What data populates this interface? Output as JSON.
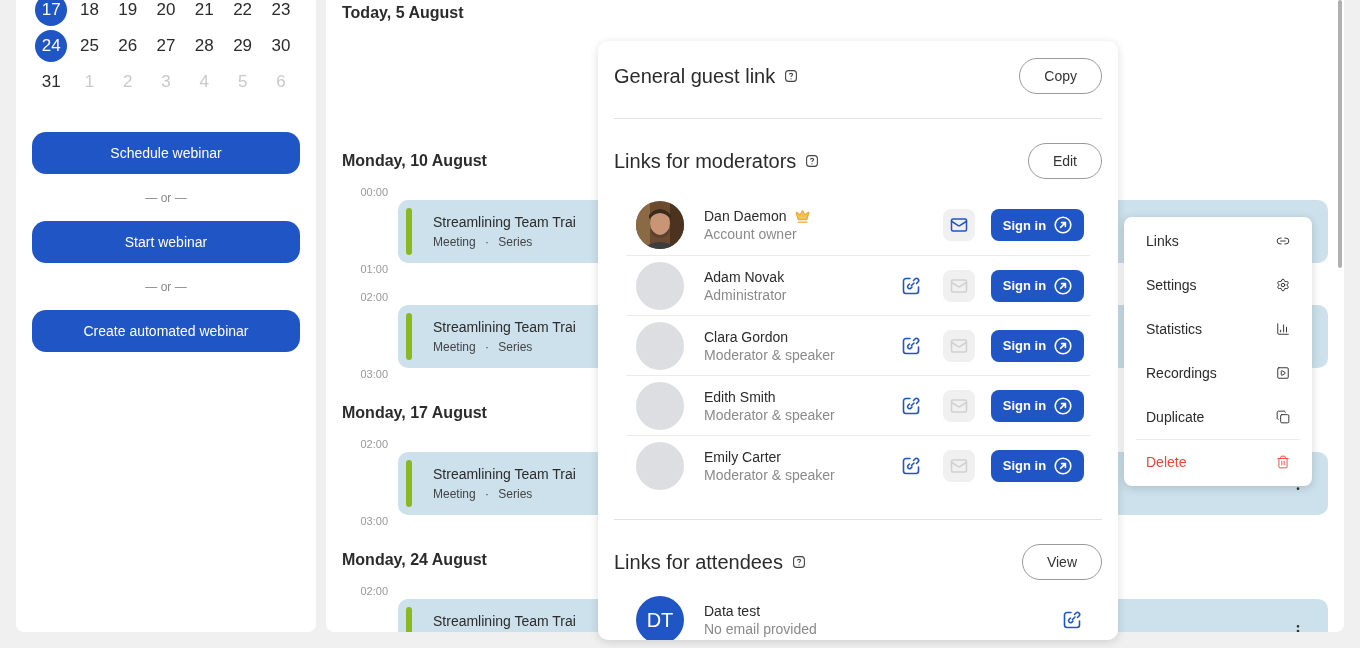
{
  "calendar": {
    "weeks": [
      [
        {
          "day": "17",
          "selected": true,
          "muted": false
        },
        {
          "day": "18",
          "selected": false,
          "muted": false
        },
        {
          "day": "19",
          "selected": false,
          "muted": false
        },
        {
          "day": "20",
          "selected": false,
          "muted": false
        },
        {
          "day": "21",
          "selected": false,
          "muted": false
        },
        {
          "day": "22",
          "selected": false,
          "muted": false
        },
        {
          "day": "23",
          "selected": false,
          "muted": false
        }
      ],
      [
        {
          "day": "24",
          "selected": true,
          "muted": false
        },
        {
          "day": "25",
          "selected": false,
          "muted": false
        },
        {
          "day": "26",
          "selected": false,
          "muted": false
        },
        {
          "day": "27",
          "selected": false,
          "muted": false
        },
        {
          "day": "28",
          "selected": false,
          "muted": false
        },
        {
          "day": "29",
          "selected": false,
          "muted": false
        },
        {
          "day": "30",
          "selected": false,
          "muted": false
        }
      ],
      [
        {
          "day": "31",
          "selected": false,
          "muted": false
        },
        {
          "day": "1",
          "selected": false,
          "muted": true
        },
        {
          "day": "2",
          "selected": false,
          "muted": true
        },
        {
          "day": "3",
          "selected": false,
          "muted": true
        },
        {
          "day": "4",
          "selected": false,
          "muted": true
        },
        {
          "day": "5",
          "selected": false,
          "muted": true
        },
        {
          "day": "6",
          "selected": false,
          "muted": true
        }
      ]
    ]
  },
  "actions": [
    {
      "kind": "button",
      "label": "Schedule webinar"
    },
    {
      "kind": "separator",
      "label": "— or —"
    },
    {
      "kind": "button",
      "label": "Start webinar"
    },
    {
      "kind": "separator",
      "label": "— or —"
    },
    {
      "kind": "button",
      "label": "Create automated webinar"
    }
  ],
  "days": [
    {
      "heading": "Today, 5 August"
    },
    {
      "heading": "Monday, 10 August",
      "events": [
        {
          "start": "00:00",
          "end": "01:00",
          "title": "Streamlining Team Trai",
          "meta": "Meeting · Series"
        },
        {
          "start": "02:00",
          "end": "03:00",
          "title": "Streamlining Team Trai",
          "meta": "Meeting · Series"
        }
      ]
    },
    {
      "heading": "Monday, 17 August",
      "events": [
        {
          "start": "02:00",
          "end": "03:00",
          "title": "Streamlining Team Trai",
          "meta": "Meeting · Series",
          "more_button": true
        }
      ]
    },
    {
      "heading": "Monday, 24 August",
      "events": [
        {
          "start": "02:00",
          "title": "Streamlining Team Trai",
          "more_button": true
        }
      ]
    }
  ],
  "links_panel": {
    "guest_link": {
      "title": "General guest link",
      "button": "Copy"
    },
    "moderators": {
      "title": "Links for moderators",
      "button": "Edit",
      "people": [
        {
          "name": "Dan Daemon",
          "role": "Account owner",
          "owner": true,
          "photo": true,
          "copy_link": false,
          "invite_enabled": true,
          "action": "Sign in"
        },
        {
          "name": "Adam Novak",
          "role": "Administrator",
          "owner": false,
          "photo": false,
          "copy_link": true,
          "invite_enabled": false,
          "action": "Sign in"
        },
        {
          "name": "Clara Gordon",
          "role": "Moderator & speaker",
          "owner": false,
          "photo": false,
          "copy_link": true,
          "invite_enabled": false,
          "action": "Sign in"
        },
        {
          "name": "Edith Smith",
          "role": "Moderator & speaker",
          "owner": false,
          "photo": false,
          "copy_link": true,
          "invite_enabled": false,
          "action": "Sign in"
        },
        {
          "name": "Emily Carter",
          "role": "Moderator & speaker",
          "owner": false,
          "photo": false,
          "copy_link": true,
          "invite_enabled": false,
          "action": "Sign in"
        }
      ]
    },
    "attendees": {
      "title": "Links for attendees",
      "button": "View",
      "people": [
        {
          "initials": "DT",
          "name": "Data test",
          "email": "No email provided"
        }
      ]
    }
  },
  "context_menu": {
    "items": [
      {
        "label": "Links",
        "danger": false
      },
      {
        "label": "Settings",
        "danger": false
      },
      {
        "label": "Statistics",
        "danger": false
      },
      {
        "label": "Recordings",
        "danger": false
      },
      {
        "label": "Duplicate",
        "danger": false
      },
      {
        "label": "Delete",
        "danger": true
      }
    ]
  }
}
